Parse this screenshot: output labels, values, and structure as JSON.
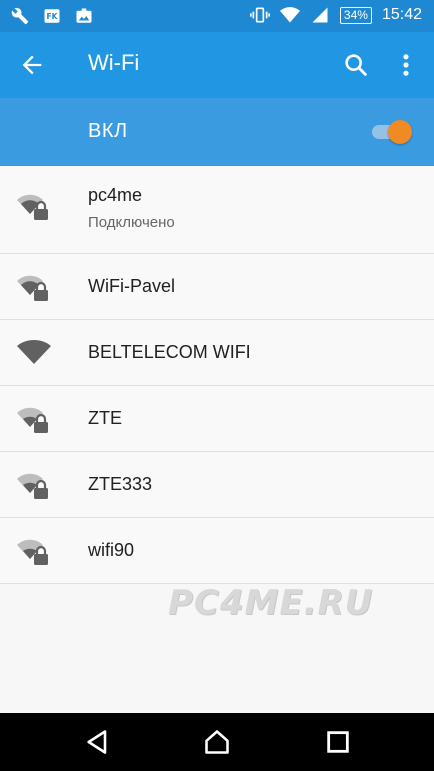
{
  "status_bar": {
    "battery": "34%",
    "time": "15:42",
    "icons": [
      "wrench-icon",
      "fk-icon",
      "image-icon",
      "vibrate-icon",
      "wifi-icon",
      "signal-icon",
      "battery-icon"
    ]
  },
  "app_bar": {
    "title": "Wi-Fi",
    "back_icon": "arrow-left-icon",
    "search_icon": "search-icon",
    "more_icon": "more-vert-icon"
  },
  "wifi_switch": {
    "label": "ВКЛ",
    "on": true,
    "accent": "#f08a24"
  },
  "networks": [
    {
      "ssid": "pc4me",
      "status": "Подключено",
      "secured": true,
      "strength": 3
    },
    {
      "ssid": "WiFi-Pavel",
      "status": "",
      "secured": true,
      "strength": 3
    },
    {
      "ssid": "BELTELECOM WIFI",
      "status": "",
      "secured": false,
      "strength": 4
    },
    {
      "ssid": "ZTE",
      "status": "",
      "secured": true,
      "strength": 2
    },
    {
      "ssid": "ZTE333",
      "status": "",
      "secured": true,
      "strength": 2
    },
    {
      "ssid": "wifi90",
      "status": "",
      "secured": true,
      "strength": 2
    }
  ],
  "watermark": "PC4ME.RU",
  "colors": {
    "status_bar": "#1e88d2",
    "app_bar": "#2196e3",
    "switch_bar": "#3a9be0"
  }
}
